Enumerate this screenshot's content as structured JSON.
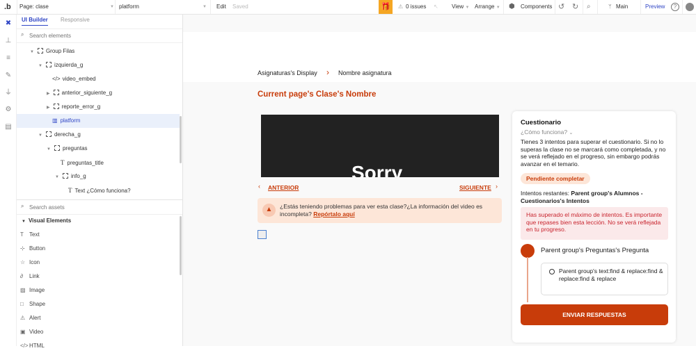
{
  "topbar": {
    "logo": ".b",
    "page": "Page: clase",
    "element": "platform",
    "edit": "Edit",
    "saved": "Saved",
    "issues": "0 issues",
    "view": "View",
    "arrange": "Arrange",
    "components": "Components",
    "branch": "Main",
    "preview": "Preview"
  },
  "panel": {
    "tabs": [
      "UI Builder",
      "Responsive"
    ],
    "search_elements_placeholder": "Search elements",
    "search_assets_placeholder": "Search assets",
    "tree": [
      {
        "label": "Group Filas"
      },
      {
        "label": "izquierda_g"
      },
      {
        "label": "video_embed"
      },
      {
        "label": "anterior_siguiente_g"
      },
      {
        "label": "reporte_error_g"
      },
      {
        "label": "platform"
      },
      {
        "label": "derecha_g"
      },
      {
        "label": "preguntas"
      },
      {
        "label": "preguntas_title"
      },
      {
        "label": "info_g"
      },
      {
        "label": "Text ¿Cómo funciona?"
      }
    ],
    "visual_elements_title": "Visual Elements",
    "assets": [
      "Text",
      "Button",
      "Icon",
      "Link",
      "Image",
      "Shape",
      "Alert",
      "Video",
      "HTML"
    ]
  },
  "page": {
    "breadcrumb_parent": "Asignaturas's Display",
    "breadcrumb_current": "Nombre asignatura",
    "title": "Current page's Clase's Nombre",
    "video_text": "Sorry",
    "prev": "ANTERIOR",
    "next": "SIGUIENTE",
    "report_text": "¿Estás teniendo problemas para ver esta clase?¿La información del video es incompleta?",
    "report_link": "Repórtalo aquí"
  },
  "quiz": {
    "title": "Cuestionario",
    "how": "¿Cómo funciona?",
    "description": "Tienes 3 intentos para superar el cuestionario. Si no lo superas la clase no se marcará como completada, y no se verá reflejado en el progreso, sin embargo podrás avanzar en el temario.",
    "status": "Pendiente completar",
    "attempts_label": "Intentos restantes:",
    "attempts_value": "Parent group's Alumnos - Cuestionarios's Intentos",
    "alert": "Has superado el máximo de intentos. Es importante que repases bien esta lección. No se verá reflejada en tu progreso.",
    "question": "Parent group's Preguntas's Pregunta",
    "option": "Parent group's text:find & replace:find & replace:find & replace",
    "submit": "ENVIAR RESPUESTAS"
  },
  "colors": {
    "accent": "#c83c0a",
    "bubble_blue": "#2f45c5",
    "gift": "#f5a623"
  }
}
